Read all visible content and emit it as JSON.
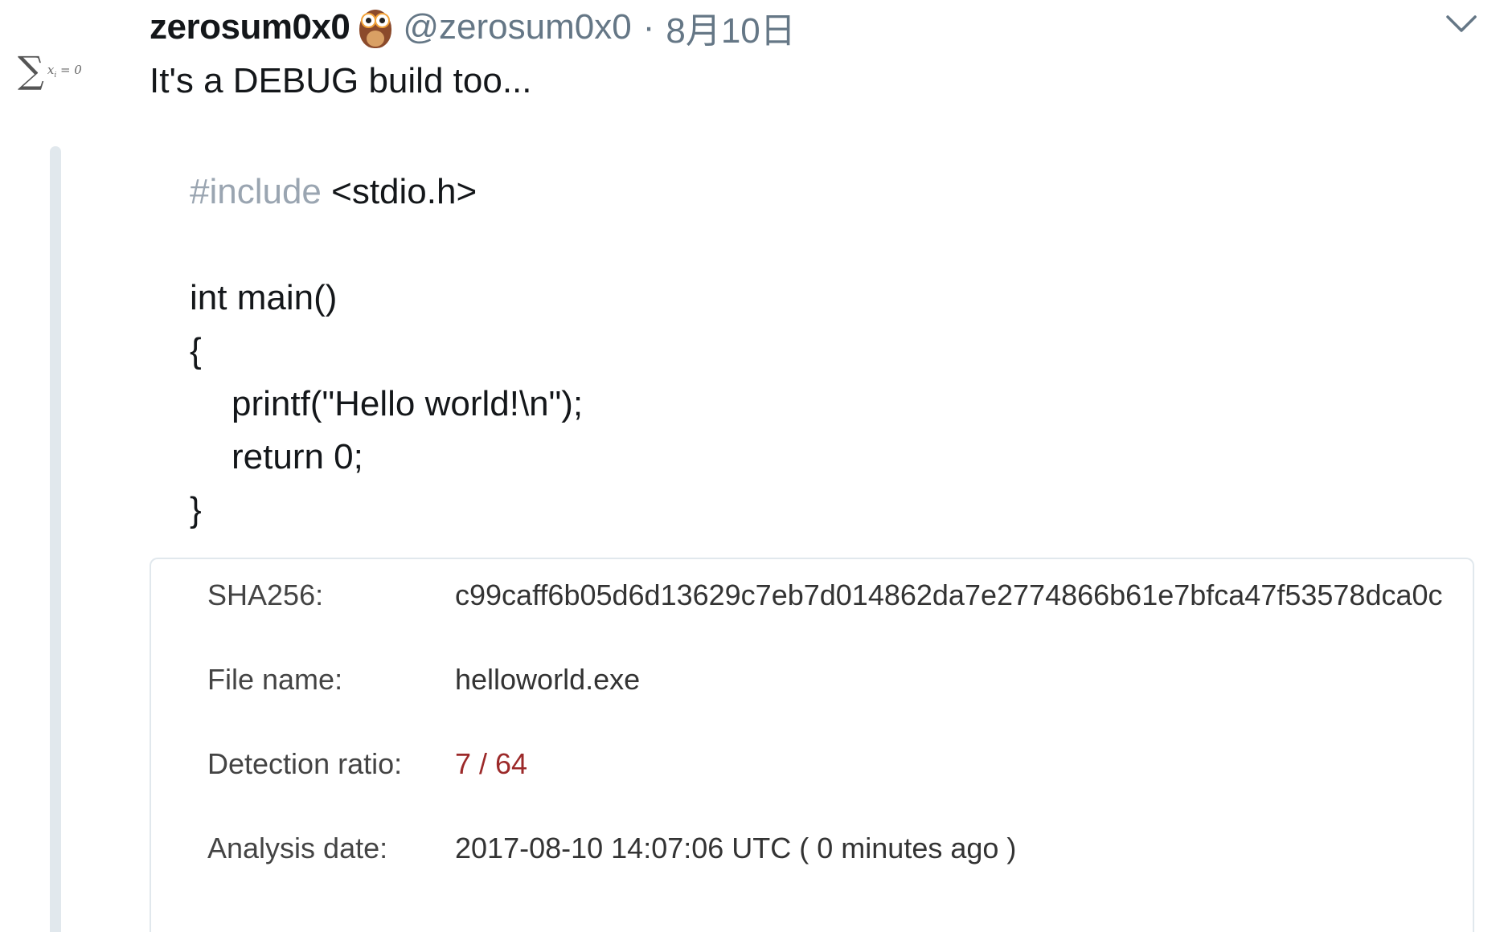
{
  "tweet": {
    "display_name": "zerosum0x0",
    "handle": "@zerosum0x0",
    "separator": "·",
    "date": "8月10日",
    "text": "It's a DEBUG build too..."
  },
  "code": {
    "include_keyword": "#include",
    "include_header": " <stdio.h>",
    "lines": [
      "int main()",
      "{",
      "printf(\"Hello world!\\n\");",
      "return 0;",
      "}"
    ]
  },
  "virustotal": {
    "rows": [
      {
        "label": "SHA256:",
        "value": "c99caff6b05d6d13629c7eb7d014862da7e2774866b61e7bfca47f53578dca0c"
      },
      {
        "label": "File name:",
        "value": "helloworld.exe"
      },
      {
        "label": "Detection ratio:",
        "value": "7 / 64"
      },
      {
        "label": "Analysis date:",
        "value": "2017-08-10 14:07:06 UTC ( 0 minutes ago )"
      }
    ]
  },
  "icons": {
    "avatar": "sigma-formula-avatar-icon",
    "emoji": "owl-icon",
    "menu": "chevron-down-icon"
  },
  "colors": {
    "secondary_text": "#657786",
    "include_keyword": "#9aa5b1",
    "detection_ratio": "#9c2a2a",
    "quote_bar": "#e1e8ed"
  }
}
